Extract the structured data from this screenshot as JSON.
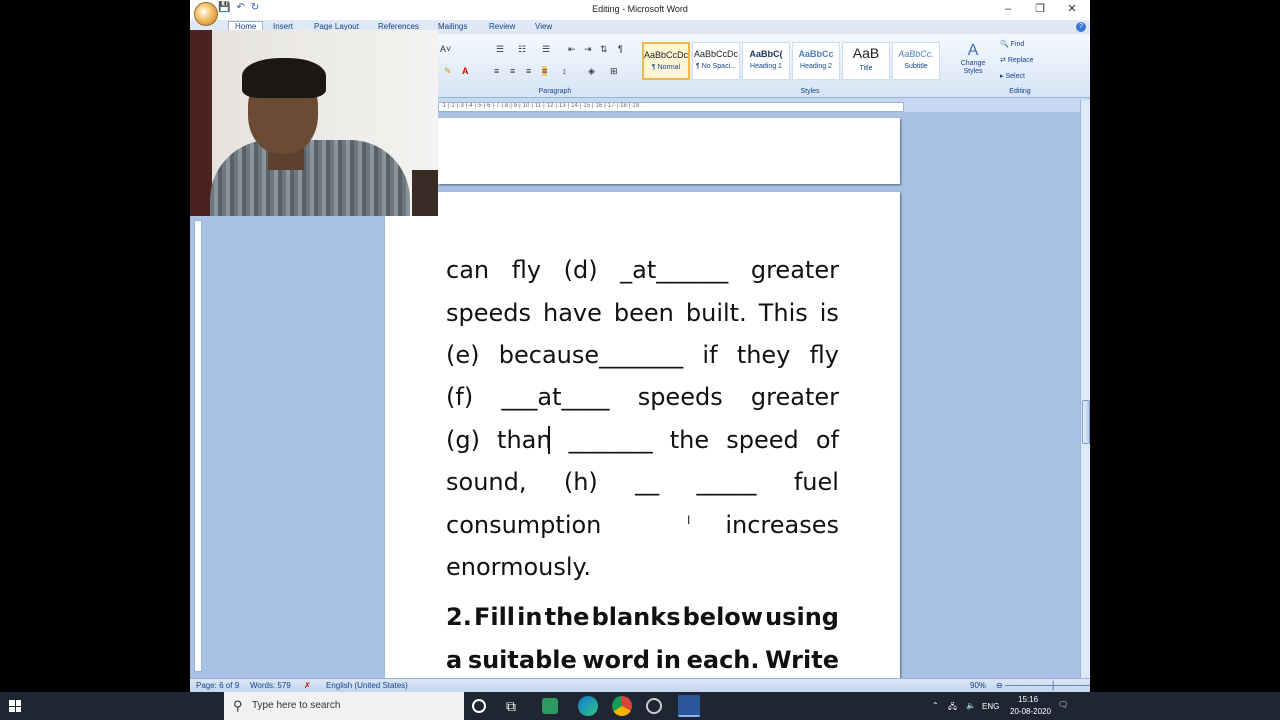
{
  "window": {
    "title": "Editing - Microsoft Word",
    "minimize": "–",
    "restore": "❐",
    "close": "✕"
  },
  "ribbon_tabs": [
    "Home",
    "Insert",
    "Page Layout",
    "References",
    "Mailings",
    "Review",
    "View"
  ],
  "ribbon": {
    "group_paragraph": "Paragraph",
    "group_styles": "Styles",
    "group_editing": "Editing",
    "styles": [
      {
        "preview": "AaBbCcDc",
        "name": "¶ Normal"
      },
      {
        "preview": "AaBbCcDc",
        "name": "¶ No Spaci..."
      },
      {
        "preview": "AaBbC(",
        "name": "Heading 1"
      },
      {
        "preview": "AaBbCc",
        "name": "Heading 2"
      },
      {
        "preview": "AaB",
        "name": "Title"
      },
      {
        "preview": "AaBbCc.",
        "name": "Subtitle"
      }
    ],
    "change_styles": "Change Styles",
    "find": "Find",
    "replace": "Replace",
    "select": "Select"
  },
  "document": {
    "lines": [
      [
        "can",
        "fly",
        "(d)",
        "_at______",
        "greater"
      ],
      [
        "speeds",
        "have",
        "been",
        "built.",
        "This",
        "is"
      ],
      [
        "(e)",
        "because_______",
        "if",
        "they",
        "fly"
      ],
      [
        "(f)",
        "___at____",
        "speeds",
        "greater"
      ],
      [
        "(g)",
        "than",
        "_______",
        "the",
        "speed",
        "of"
      ],
      [
        "sound,",
        "(h)",
        "__",
        "_____",
        "fuel"
      ],
      [
        "consumption",
        "increases"
      ],
      [
        "enormously."
      ],
      [
        "2.",
        "Fill",
        "in",
        "the",
        "blanks",
        "below",
        "using"
      ],
      [
        "a",
        "suitable",
        "word",
        "in",
        "each.",
        "Write"
      ]
    ]
  },
  "status": {
    "page": "Page: 6 of 9",
    "words": "Words: 579",
    "language": "English (United States)",
    "zoom": "90%"
  },
  "taskbar": {
    "search_placeholder": "Type here to search",
    "lang": "ENG",
    "time": "15:16",
    "date": "20-08-2020"
  },
  "colors": {
    "ribbon_accent": "#15428b",
    "taskbar": "#1f2533"
  }
}
